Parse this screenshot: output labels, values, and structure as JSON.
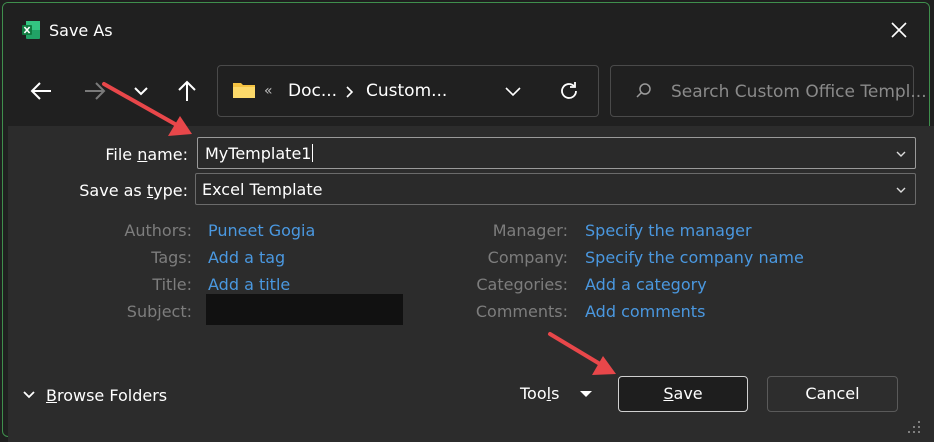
{
  "window": {
    "title": "Save As"
  },
  "address": {
    "overflow": "«",
    "crumbs": [
      "Doc...",
      "Custom..."
    ]
  },
  "search": {
    "placeholder": "Search Custom Office Templ..."
  },
  "form": {
    "file_name_label_prefix": "File ",
    "file_name_label_underlined": "n",
    "file_name_label_suffix": "ame:",
    "file_name_value": "MyTemplate1",
    "save_type_label_prefix": "Save as ",
    "save_type_label_underlined": "t",
    "save_type_label_suffix": "ype:",
    "save_type_value": "Excel Template"
  },
  "metadata": {
    "left": [
      {
        "label": "Authors:",
        "value": "Puneet Gogia"
      },
      {
        "label": "Tags:",
        "value": "Add a tag"
      },
      {
        "label": "Title:",
        "value": "Add a title"
      },
      {
        "label": "Subject:",
        "value": ""
      }
    ],
    "right": [
      {
        "label": "Manager:",
        "value": "Specify the manager"
      },
      {
        "label": "Company:",
        "value": "Specify the company name"
      },
      {
        "label": "Categories:",
        "value": "Add a category"
      },
      {
        "label": "Comments:",
        "value": "Add comments"
      }
    ]
  },
  "footer": {
    "browse_underlined": "B",
    "browse_rest": "rowse Folders",
    "tools_prefix": "Too",
    "tools_underlined": "l",
    "tools_suffix": "s",
    "save_underlined": "S",
    "save_rest": "ave",
    "cancel_label": "Cancel"
  },
  "colors": {
    "accent_link": "#4a98e0",
    "annotation_arrow": "#e8474a",
    "folder": "#f5c342",
    "excel_green": "#1e7145"
  },
  "icons": [
    "excel-icon",
    "close-icon",
    "back-arrow-icon",
    "forward-arrow-icon",
    "recent-dropdown-icon",
    "up-arrow-icon",
    "folder-icon",
    "chevron-down-icon",
    "refresh-icon",
    "search-icon",
    "browse-chevron-icon",
    "tools-dropdown-icon"
  ]
}
